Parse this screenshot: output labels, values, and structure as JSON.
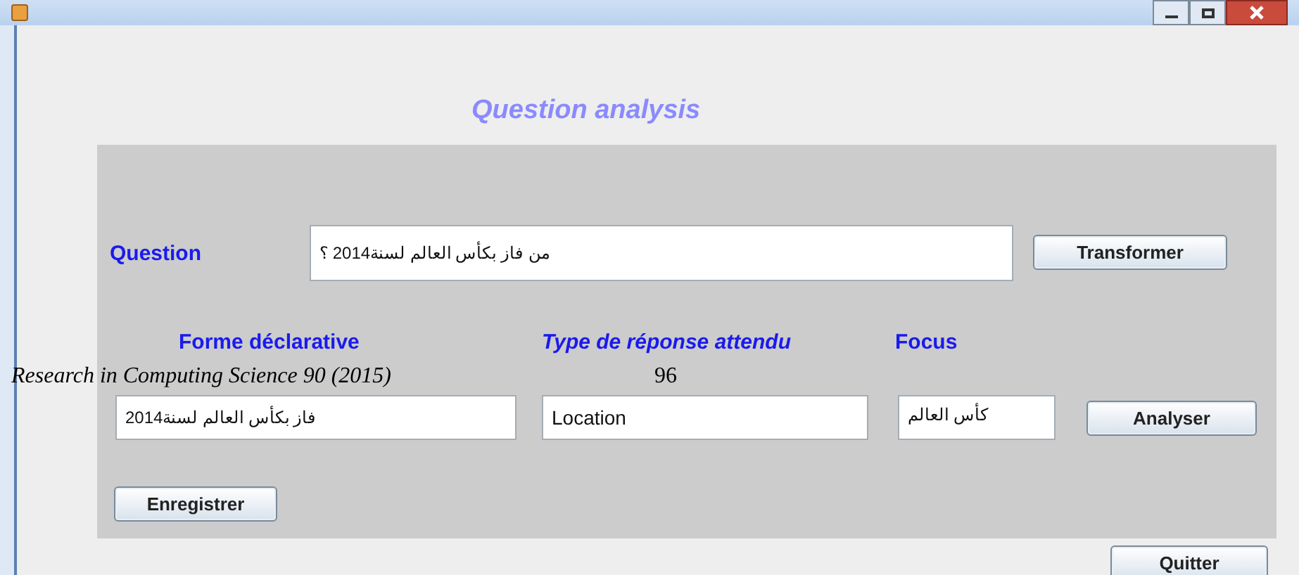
{
  "window": {
    "heading": "Question analysis"
  },
  "question": {
    "label": "Question",
    "value": "من فاز بكأس العالم لسنة2014 ؟",
    "button": "Transformer"
  },
  "declarative_form": {
    "label": "Forme déclarative",
    "value": "فاز بكأس العالم لسنة2014"
  },
  "answer_type": {
    "label": "Type de réponse attendu",
    "value": "Location"
  },
  "focus": {
    "label": "Focus",
    "value": "كأس العالم"
  },
  "analyse_button": "Analyser",
  "save_button": "Enregistrer",
  "quit_button": "Quitter",
  "page_header": {
    "journal": "Research in Computing Science 90 (2015)",
    "page": "96"
  }
}
